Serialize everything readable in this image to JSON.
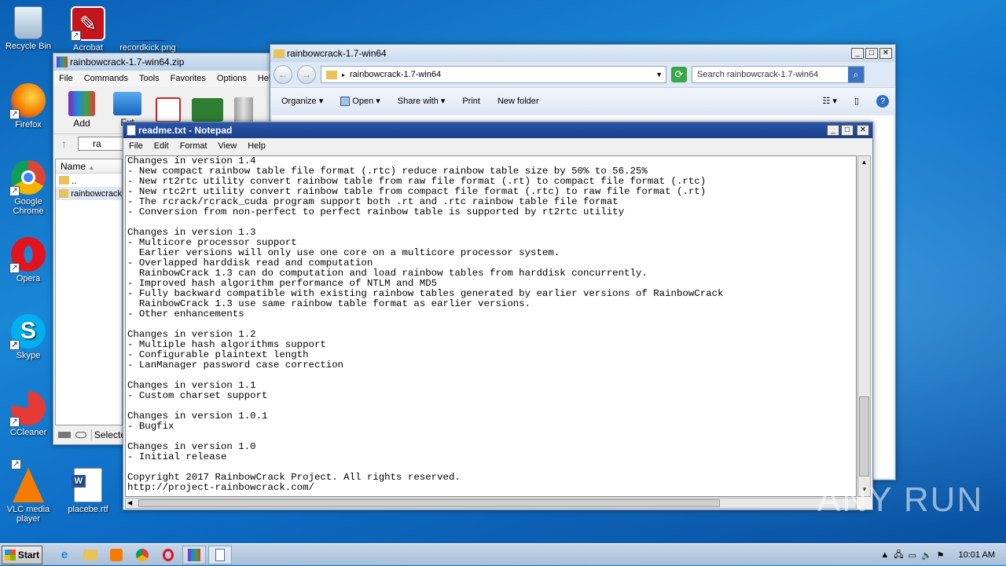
{
  "desktop": {
    "icons": [
      {
        "label": "Recycle Bin"
      },
      {
        "label": "Acrobat"
      },
      {
        "label": "recordkick.png"
      },
      {
        "label": "Firefox"
      },
      {
        "label": "Google\nChrome"
      },
      {
        "label": "Opera"
      },
      {
        "label": "Skype"
      },
      {
        "label": "CCleaner"
      },
      {
        "label": "VLC media\nplayer"
      },
      {
        "label": "placebe.rtf"
      }
    ]
  },
  "winrar": {
    "title": "rainbowcrack-1.7-win64.zip",
    "menu": [
      "File",
      "Commands",
      "Tools",
      "Favorites",
      "Options",
      "Help"
    ],
    "toolbar": [
      "Add",
      "Ext"
    ],
    "path": "ra",
    "column_name": "Name",
    "rows": [
      "..",
      "rainbowcrack"
    ],
    "status": "Selected"
  },
  "explorer": {
    "title": "rainbowcrack-1.7-win64",
    "address": "rainbowcrack-1.7-win64",
    "search_placeholder": "Search rainbowcrack-1.7-win64",
    "toolbar": {
      "organize": "Organize",
      "open": "Open",
      "share": "Share with",
      "print": "Print",
      "new_folder": "New folder"
    }
  },
  "notepad": {
    "title": "readme.txt - Notepad",
    "menu": [
      "File",
      "Edit",
      "Format",
      "View",
      "Help"
    ],
    "content": "Changes in version 1.4\n- New compact rainbow table file format (.rtc) reduce rainbow table size by 50% to 56.25%\n- New rt2rtc utility convert rainbow table from raw file format (.rt) to compact file format (.rtc)\n- New rtc2rt utility convert rainbow table from compact file format (.rtc) to raw file format (.rt)\n- The rcrack/rcrack_cuda program support both .rt and .rtc rainbow table file format\n- Conversion from non-perfect to perfect rainbow table is supported by rt2rtc utility\n\nChanges in version 1.3\n- Multicore processor support\n  Earlier versions will only use one core on a multicore processor system.\n- Overlapped harddisk read and computation\n  RainbowCrack 1.3 can do computation and load rainbow tables from harddisk concurrently.\n- Improved hash algorithm performance of NTLM and MD5\n- Fully backward compatible with existing rainbow tables generated by earlier versions of RainbowCrack\n  RainbowCrack 1.3 use same rainbow table format as earlier versions.\n- Other enhancements\n\nChanges in version 1.2\n- Multiple hash algorithms support\n- Configurable plaintext length\n- LanManager password case correction\n\nChanges in version 1.1\n- Custom charset support\n\nChanges in version 1.0.1\n- Bugfix\n\nChanges in version 1.0\n- Initial release\n\nCopyright 2017 RainbowCrack Project. All rights reserved.\nhttp://project-rainbowcrack.com/"
  },
  "taskbar": {
    "start": "Start",
    "clock": "10:01 AM"
  },
  "watermark": "ANY RUN"
}
